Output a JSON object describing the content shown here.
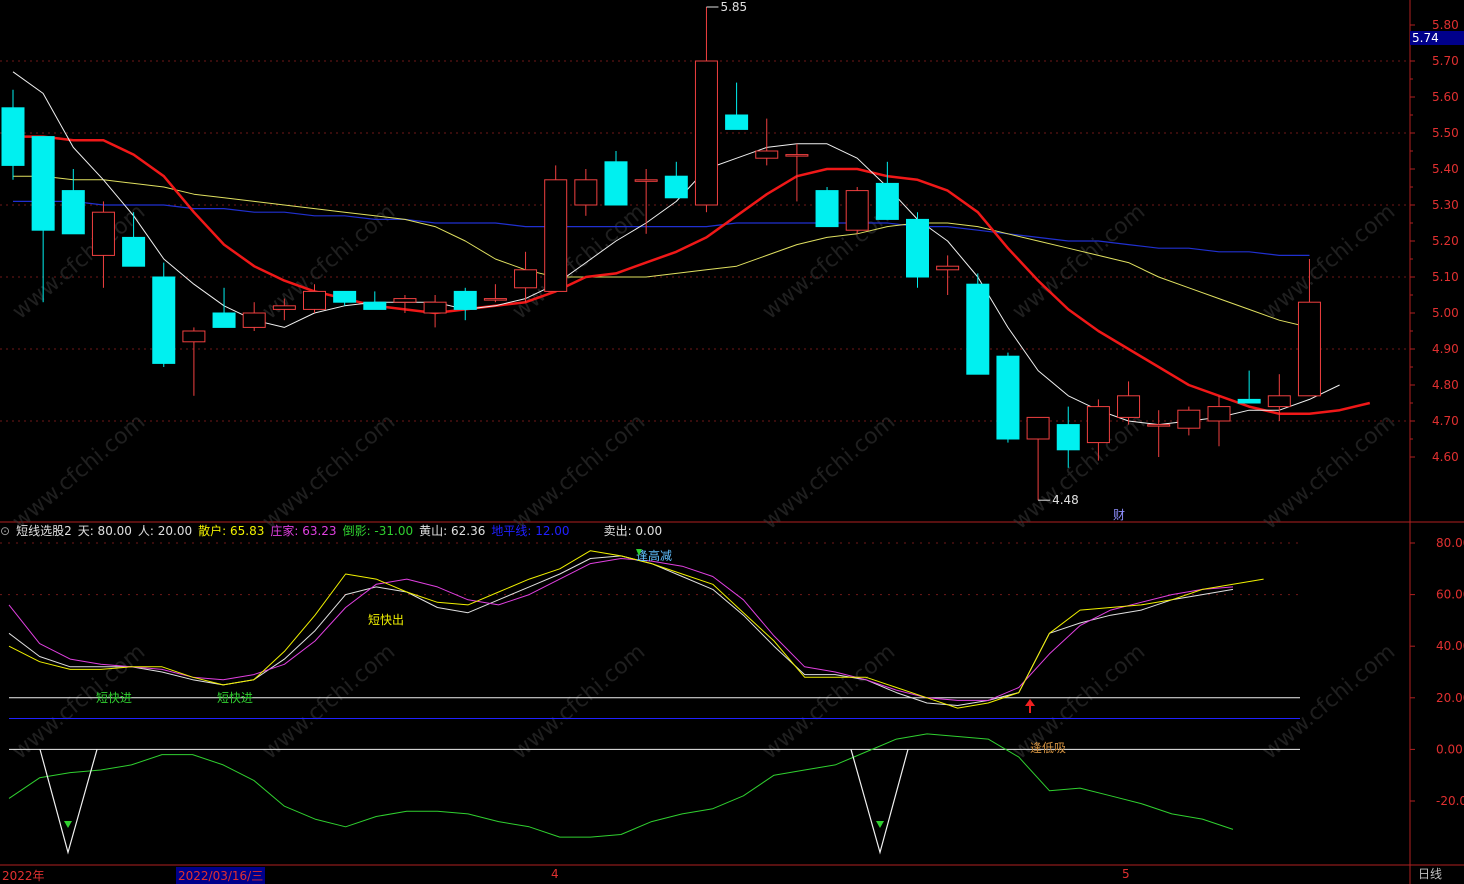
{
  "price_axis_labels": [
    "5.80",
    "5.70",
    "5.60",
    "5.50",
    "5.40",
    "5.30",
    "5.20",
    "5.10",
    "5.00",
    "4.90",
    "4.80",
    "4.70",
    "4.60"
  ],
  "current_price": "5.74",
  "high_label": "5.85",
  "low_label": "4.48",
  "finance_marker": "财",
  "indicator": {
    "name": "短线选股2",
    "params": [
      {
        "label": "天: 80.00",
        "color": "#e0e0e0"
      },
      {
        "label": "人: 20.00",
        "color": "#e0e0e0"
      },
      {
        "label": "散户: 65.83",
        "color": "#f0f000"
      },
      {
        "label": "庄家: 63.23",
        "color": "#e040e0"
      },
      {
        "label": "倒影: -31.00",
        "color": "#30d030"
      },
      {
        "label": "黄山: 62.36",
        "color": "#e0e0e0"
      },
      {
        "label": "地平线: 12.00",
        "color": "#2020ff"
      },
      {
        "label": "卖出: 0.00",
        "color": "#e0e0e0"
      }
    ],
    "axis_labels": [
      "80.00",
      "60.00",
      "40.00",
      "20.00",
      "0.00",
      "-20.00"
    ],
    "signals": [
      {
        "text": "逢高减",
        "color": "#60c0ff"
      },
      {
        "text": "短快出",
        "color": "#f0f000"
      },
      {
        "text": "短快进",
        "color": "#30d030"
      },
      {
        "text": "短快进",
        "color": "#30d030"
      },
      {
        "text": "逢低吸",
        "color": "#d09040"
      }
    ]
  },
  "x_axis": {
    "year": "2022年",
    "current_date": "2022/03/16/三",
    "month_4": "4",
    "month_5": "5"
  },
  "period": "日线",
  "watermark": "www.cfchi.com",
  "chart_data": [
    {
      "type": "candlestick",
      "ylim": [
        4.45,
        5.85
      ],
      "candles": [
        {
          "o": 5.57,
          "h": 5.62,
          "l": 5.37,
          "c": 5.41
        },
        {
          "o": 5.49,
          "h": 5.49,
          "l": 5.03,
          "c": 5.23
        },
        {
          "o": 5.34,
          "h": 5.4,
          "l": 5.22,
          "c": 5.22
        },
        {
          "o": 5.16,
          "h": 5.31,
          "l": 5.07,
          "c": 5.28
        },
        {
          "o": 5.21,
          "h": 5.28,
          "l": 5.13,
          "c": 5.13
        },
        {
          "o": 5.1,
          "h": 5.14,
          "l": 4.85,
          "c": 4.86
        },
        {
          "o": 4.92,
          "h": 4.96,
          "l": 4.77,
          "c": 4.95
        },
        {
          "o": 5.0,
          "h": 5.07,
          "l": 4.96,
          "c": 4.96
        },
        {
          "o": 4.96,
          "h": 5.03,
          "l": 4.95,
          "c": 5.0
        },
        {
          "o": 5.01,
          "h": 5.04,
          "l": 4.98,
          "c": 5.02
        },
        {
          "o": 5.01,
          "h": 5.08,
          "l": 5.0,
          "c": 5.06
        },
        {
          "o": 5.06,
          "h": 5.06,
          "l": 5.02,
          "c": 5.03
        },
        {
          "o": 5.03,
          "h": 5.06,
          "l": 5.01,
          "c": 5.01
        },
        {
          "o": 5.03,
          "h": 5.05,
          "l": 5.0,
          "c": 5.04
        },
        {
          "o": 5.0,
          "h": 5.05,
          "l": 4.96,
          "c": 5.03
        },
        {
          "o": 5.06,
          "h": 5.07,
          "l": 4.98,
          "c": 5.01
        },
        {
          "o": 5.04,
          "h": 5.08,
          "l": 5.03,
          "c": 5.04
        },
        {
          "o": 5.07,
          "h": 5.17,
          "l": 5.03,
          "c": 5.12
        },
        {
          "o": 5.06,
          "h": 5.41,
          "l": 5.06,
          "c": 5.37
        },
        {
          "o": 5.3,
          "h": 5.4,
          "l": 5.27,
          "c": 5.37
        },
        {
          "o": 5.42,
          "h": 5.45,
          "l": 5.3,
          "c": 5.3
        },
        {
          "o": 5.37,
          "h": 5.4,
          "l": 5.22,
          "c": 5.37
        },
        {
          "o": 5.38,
          "h": 5.42,
          "l": 5.32,
          "c": 5.32
        },
        {
          "o": 5.3,
          "h": 5.85,
          "l": 5.28,
          "c": 5.7
        },
        {
          "o": 5.55,
          "h": 5.64,
          "l": 5.51,
          "c": 5.51
        },
        {
          "o": 5.43,
          "h": 5.54,
          "l": 5.41,
          "c": 5.45
        },
        {
          "o": 5.44,
          "h": 5.47,
          "l": 5.31,
          "c": 5.44
        },
        {
          "o": 5.34,
          "h": 5.35,
          "l": 5.24,
          "c": 5.24
        },
        {
          "o": 5.23,
          "h": 5.35,
          "l": 5.22,
          "c": 5.34
        },
        {
          "o": 5.36,
          "h": 5.42,
          "l": 5.26,
          "c": 5.26
        },
        {
          "o": 5.26,
          "h": 5.28,
          "l": 5.07,
          "c": 5.1
        },
        {
          "o": 5.12,
          "h": 5.16,
          "l": 5.05,
          "c": 5.13
        },
        {
          "o": 5.08,
          "h": 5.11,
          "l": 4.83,
          "c": 4.83
        },
        {
          "o": 4.88,
          "h": 4.89,
          "l": 4.64,
          "c": 4.65
        },
        {
          "o": 4.65,
          "h": 4.71,
          "l": 4.48,
          "c": 4.71
        },
        {
          "o": 4.69,
          "h": 4.74,
          "l": 4.57,
          "c": 4.62
        },
        {
          "o": 4.64,
          "h": 4.76,
          "l": 4.59,
          "c": 4.74
        },
        {
          "o": 4.71,
          "h": 4.81,
          "l": 4.69,
          "c": 4.77
        },
        {
          "o": 4.69,
          "h": 4.73,
          "l": 4.6,
          "c": 4.69
        },
        {
          "o": 4.68,
          "h": 4.74,
          "l": 4.66,
          "c": 4.73
        },
        {
          "o": 4.7,
          "h": 4.77,
          "l": 4.63,
          "c": 4.74
        },
        {
          "o": 4.76,
          "h": 4.84,
          "l": 4.75,
          "c": 4.75
        },
        {
          "o": 4.74,
          "h": 4.83,
          "l": 4.7,
          "c": 4.77
        },
        {
          "o": 4.77,
          "h": 5.15,
          "l": 4.77,
          "c": 5.03
        }
      ],
      "ma_white": [
        5.67,
        5.61,
        5.46,
        5.37,
        5.27,
        5.15,
        5.08,
        5.02,
        4.98,
        4.96,
        5.0,
        5.02,
        5.03,
        5.03,
        5.03,
        5.01,
        5.02,
        5.04,
        5.08,
        5.14,
        5.2,
        5.25,
        5.31,
        5.4,
        5.43,
        5.46,
        5.47,
        5.47,
        5.43,
        5.35,
        5.26,
        5.2,
        5.1,
        4.96,
        4.84,
        4.77,
        4.73,
        4.7,
        4.69,
        4.7,
        4.71,
        4.73,
        4.73,
        4.76,
        4.8
      ],
      "ma_red": [
        5.49,
        5.49,
        5.48,
        5.48,
        5.44,
        5.38,
        5.28,
        5.19,
        5.13,
        5.09,
        5.06,
        5.04,
        5.02,
        5.01,
        5.0,
        5.01,
        5.02,
        5.03,
        5.06,
        5.1,
        5.11,
        5.14,
        5.17,
        5.21,
        5.27,
        5.33,
        5.38,
        5.4,
        5.4,
        5.38,
        5.37,
        5.34,
        5.28,
        5.18,
        5.09,
        5.01,
        4.95,
        4.9,
        4.85,
        4.8,
        4.77,
        4.74,
        4.72,
        4.72,
        4.73,
        4.75
      ],
      "ma_yellow": [
        5.38,
        5.38,
        5.37,
        5.37,
        5.36,
        5.35,
        5.33,
        5.32,
        5.31,
        5.3,
        5.29,
        5.28,
        5.27,
        5.26,
        5.24,
        5.2,
        5.15,
        5.12,
        5.1,
        5.1,
        5.1,
        5.1,
        5.11,
        5.12,
        5.13,
        5.16,
        5.19,
        5.21,
        5.22,
        5.24,
        5.25,
        5.25,
        5.24,
        5.22,
        5.2,
        5.18,
        5.16,
        5.14,
        5.1,
        5.07,
        5.04,
        5.01,
        4.98,
        4.96
      ],
      "ma_blue": [
        5.31,
        5.31,
        5.31,
        5.3,
        5.3,
        5.3,
        5.29,
        5.29,
        5.28,
        5.28,
        5.27,
        5.27,
        5.26,
        5.26,
        5.25,
        5.25,
        5.25,
        5.24,
        5.24,
        5.24,
        5.24,
        5.24,
        5.24,
        5.24,
        5.25,
        5.25,
        5.25,
        5.25,
        5.25,
        5.25,
        5.24,
        5.24,
        5.23,
        5.22,
        5.21,
        5.2,
        5.2,
        5.19,
        5.18,
        5.18,
        5.17,
        5.17,
        5.16,
        5.16
      ]
    },
    {
      "type": "line",
      "ylim": [
        -35,
        85
      ],
      "series": [
        {
          "name": "散户",
          "color": "#f0f000",
          "values": [
            40,
            34,
            31,
            31,
            32,
            32,
            28,
            25,
            27,
            38,
            52,
            68,
            66,
            61,
            57,
            56,
            61,
            66,
            70,
            77,
            75,
            72,
            68,
            64,
            53,
            42,
            28,
            28,
            28,
            24,
            20,
            16,
            18,
            22,
            45,
            54,
            55,
            56,
            58,
            62,
            64,
            66
          ]
        },
        {
          "name": "庄家",
          "color": "#e040e0",
          "values": [
            56,
            41,
            35,
            33,
            32,
            31,
            28,
            27,
            29,
            33,
            42,
            55,
            64,
            66,
            63,
            58,
            56,
            60,
            66,
            72,
            74,
            73,
            71,
            67,
            58,
            44,
            32,
            30,
            27,
            23,
            20,
            19,
            19,
            24,
            37,
            48,
            54,
            57,
            60,
            62,
            63
          ]
        },
        {
          "name": "黄山",
          "color": "#e0e0e0",
          "values": [
            45,
            36,
            32,
            32,
            32,
            30,
            27,
            25,
            27,
            35,
            46,
            60,
            63,
            61,
            55,
            53,
            58,
            63,
            68,
            74,
            75,
            72,
            67,
            62,
            52,
            40,
            29,
            29,
            27,
            22,
            18,
            17,
            19,
            22,
            45,
            49,
            52,
            54,
            58,
            60,
            62
          ]
        },
        {
          "name": "倒影",
          "color": "#30d030",
          "values": [
            -19,
            -11,
            -9,
            -8,
            -6,
            -2,
            -2,
            -6,
            -12,
            -22,
            -27,
            -30,
            -26,
            -24,
            -24,
            -25,
            -28,
            -30,
            -34,
            -34,
            -33,
            -28,
            -25,
            -23,
            -18,
            -10,
            -8,
            -6,
            -1,
            4,
            6,
            5,
            4,
            -3,
            -16,
            -15,
            -18,
            -21,
            -25,
            -27,
            -31
          ]
        },
        {
          "name": "人",
          "color": "#f0f0f0",
          "values": [
            20
          ]
        },
        {
          "name": "地平线",
          "color": "#2020ff",
          "values": [
            12
          ]
        }
      ]
    }
  ]
}
